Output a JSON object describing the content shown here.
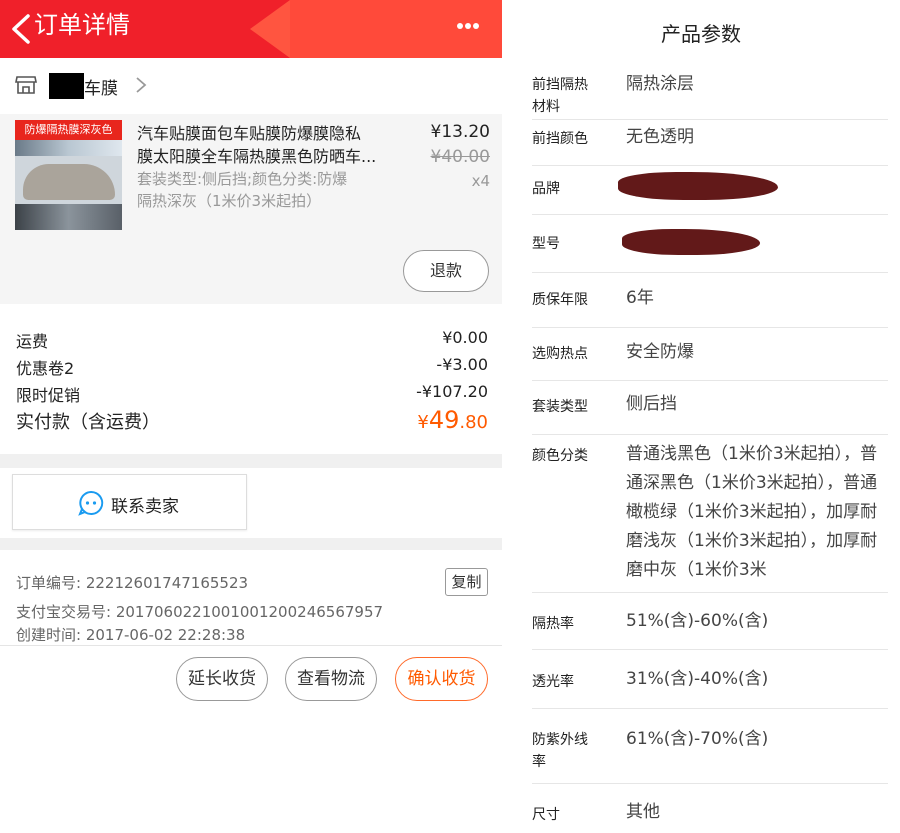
{
  "left": {
    "header": {
      "title": "订单详情"
    },
    "shop": {
      "name": "车膜"
    },
    "item": {
      "thumb_banner": "防爆隔热膜深灰色",
      "title_line1": "汽车贴膜面包车贴膜防爆膜隐私",
      "title_line2": "膜太阳膜全车隔热膜黑色防晒车...",
      "sku_line1": "套装类型:侧后挡;颜色分类:防爆",
      "sku_line2": "隔热深灰（1米价3米起拍）",
      "price": "¥13.20",
      "original_price": "¥40.00",
      "quantity": "x4",
      "refund_label": "退款"
    },
    "fees": [
      {
        "label": "运费",
        "value": "¥0.00"
      },
      {
        "label": "优惠卷2",
        "value": "-¥3.00"
      },
      {
        "label": "限时促销",
        "value": "-¥107.20"
      }
    ],
    "total": {
      "label": "实付款（含运费）",
      "currency": "¥",
      "integer": "49",
      "decimal": ".80"
    },
    "contact_label": "联系卖家",
    "order_info": {
      "order_no": "订单编号: 22212601747165523",
      "alipay_no": "支付宝交易号: 2017060221001001200246567957",
      "created": "创建时间: 2017-06-02 22:28:38",
      "copy_label": "复制"
    },
    "actions": {
      "extend": "延长收货",
      "logistics": "查看物流",
      "confirm": "确认收货"
    }
  },
  "right": {
    "title": "产品参数",
    "params": [
      {
        "key": "前挡隔热材料",
        "value": "隔热涂层"
      },
      {
        "key": "前挡颜色",
        "value": "无色透明"
      },
      {
        "key": "品牌",
        "value": ""
      },
      {
        "key": "型号",
        "value": ""
      },
      {
        "key": "质保年限",
        "value": "6年"
      },
      {
        "key": "选购热点",
        "value": "安全防爆"
      },
      {
        "key": "套装类型",
        "value": "侧后挡"
      },
      {
        "key": "颜色分类",
        "value": "普通浅黑色（1米价3米起拍），普通深黑色（1米价3米起拍），普通橄榄绿（1米价3米起拍），加厚耐磨浅灰（1米价3米起拍），加厚耐磨中灰（1米价3米"
      },
      {
        "key": "隔热率",
        "value": "51%(含)-60%(含)"
      },
      {
        "key": "透光率",
        "value": "31%(含)-40%(含)"
      },
      {
        "key": "防紫外线率",
        "value": "61%(含)-70%(含)"
      },
      {
        "key": "尺寸",
        "value": "其他"
      }
    ]
  }
}
